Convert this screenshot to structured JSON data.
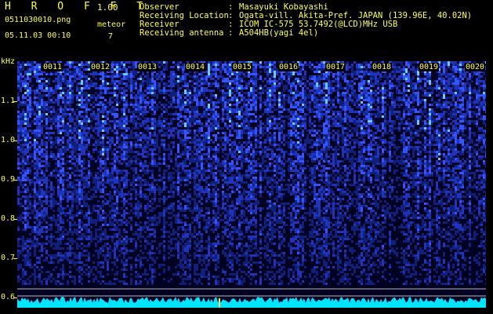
{
  "header": {
    "app_title": "H R O F F T",
    "app_version": "1.00",
    "file_name": "0511030010.png",
    "date_time": "05.11.03 00:10",
    "meteor_label": "meteor",
    "meteor_count": "7"
  },
  "info": [
    {
      "label": "Observer",
      "sep": ":",
      "value": "Masayuki Kobayashi"
    },
    {
      "label": "Receiving Location",
      "sep": ":",
      "value": "Ogata-vill. Akita-Pref. JAPAN (139.96E, 40.02N)"
    },
    {
      "label": "Receiver",
      "sep": ":",
      "value": "ICOM IC-575 53.7492(@LCD)MHz USB"
    },
    {
      "label": "Receiving antenna",
      "sep": ":",
      "value": "A504HB(yagi 4el)"
    }
  ],
  "spectrogram": {
    "y_unit": "kHz",
    "y_ticks": [
      "1.1",
      "1.0",
      "0.9",
      "0.8",
      "0.7",
      "0.6"
    ],
    "x_ticks": [
      "0011",
      "0012",
      "0013",
      "0014",
      "0015",
      "0016",
      "0017",
      "0018",
      "0019",
      "0020"
    ],
    "colors": {
      "background": "#000033",
      "signal": "#3355ff",
      "grid": "#ffff55",
      "baseline": "#00e5ff"
    }
  }
}
